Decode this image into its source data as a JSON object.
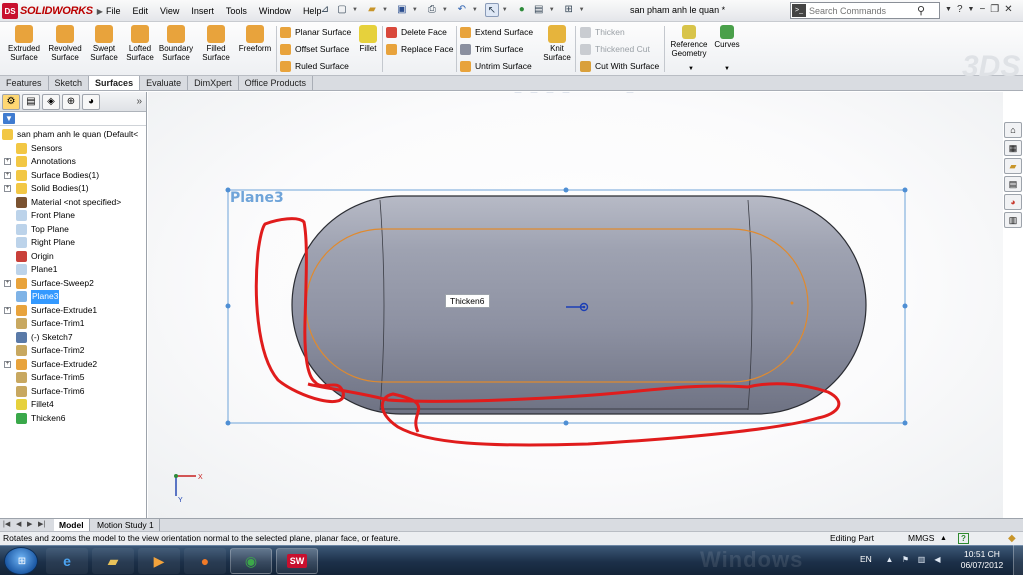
{
  "app": {
    "logo_text": "SOLIDWORKS",
    "logo_badge": "DS",
    "document_title": "san pham anh le quan *",
    "menu": [
      "File",
      "Edit",
      "View",
      "Insert",
      "Tools",
      "Window",
      "Help"
    ],
    "search_placeholder": "Search Commands",
    "watermark": "3DS"
  },
  "ribbon": {
    "big_buttons": [
      {
        "label1": "Extruded",
        "label2": "Surface",
        "icon": "extruded-surface-icon",
        "color": "#e8a33c"
      },
      {
        "label1": "Revolved",
        "label2": "Surface",
        "icon": "revolved-surface-icon",
        "color": "#e8a33c"
      },
      {
        "label1": "Swept",
        "label2": "Surface",
        "icon": "swept-surface-icon",
        "color": "#e8a33c"
      },
      {
        "label1": "Lofted",
        "label2": "Surface",
        "icon": "lofted-surface-icon",
        "color": "#e8a33c"
      },
      {
        "label1": "Boundary",
        "label2": "Surface",
        "icon": "boundary-surface-icon",
        "color": "#e8a33c"
      },
      {
        "label1": "Filled",
        "label2": "Surface",
        "icon": "filled-surface-icon",
        "color": "#e8a33c"
      },
      {
        "label1": "Freeform",
        "label2": "",
        "icon": "freeform-icon",
        "color": "#e8a33c"
      }
    ],
    "col1": [
      "Planar Surface",
      "Offset Surface",
      "Ruled Surface"
    ],
    "fillet": "Fillet",
    "col2": [
      "Delete Face",
      "Replace Face"
    ],
    "col3": [
      "Extend Surface",
      "Trim Surface",
      "Untrim Surface"
    ],
    "knit": {
      "label1": "Knit",
      "label2": "Surface"
    },
    "col4": [
      "Thicken",
      "Thickened Cut",
      "Cut With Surface"
    ],
    "ref_geometry": {
      "label1": "Reference",
      "label2": "Geometry"
    },
    "curves": "Curves"
  },
  "tabs": [
    "Features",
    "Sketch",
    "Surfaces",
    "Evaluate",
    "DimXpert",
    "Office Products"
  ],
  "active_tab": "Surfaces",
  "tree": {
    "root": "san pham anh le quan  (Default<",
    "items": [
      {
        "label": "Sensors",
        "expandable": false,
        "icon_color": "#f2c744"
      },
      {
        "label": "Annotations",
        "expandable": true,
        "icon_color": "#f2c744"
      },
      {
        "label": "Surface Bodies(1)",
        "expandable": true,
        "icon_color": "#f2c744"
      },
      {
        "label": "Solid Bodies(1)",
        "expandable": true,
        "icon_color": "#f2c744"
      },
      {
        "label": "Material <not specified>",
        "expandable": false,
        "icon_color": "#7a5230"
      },
      {
        "label": "Front Plane",
        "expandable": false,
        "icon_color": "#bcd3ea"
      },
      {
        "label": "Top Plane",
        "expandable": false,
        "icon_color": "#bcd3ea"
      },
      {
        "label": "Right Plane",
        "expandable": false,
        "icon_color": "#bcd3ea"
      },
      {
        "label": "Origin",
        "expandable": false,
        "icon_color": "#c9403a"
      },
      {
        "label": "Plane1",
        "expandable": false,
        "icon_color": "#bcd3ea"
      },
      {
        "label": "Surface-Sweep2",
        "expandable": true,
        "icon_color": "#e8a33c"
      },
      {
        "label": "Plane3",
        "expandable": false,
        "icon_color": "#7fb3e6",
        "selected": true
      },
      {
        "label": "Surface-Extrude1",
        "expandable": true,
        "icon_color": "#e8a33c"
      },
      {
        "label": "Surface-Trim1",
        "expandable": false,
        "icon_color": "#c8a860"
      },
      {
        "label": "(-) Sketch7",
        "expandable": false,
        "icon_color": "#5a7aa8"
      },
      {
        "label": "Surface-Trim2",
        "expandable": false,
        "icon_color": "#c8a860"
      },
      {
        "label": "Surface-Extrude2",
        "expandable": true,
        "icon_color": "#e8a33c"
      },
      {
        "label": "Surface-Trim5",
        "expandable": false,
        "icon_color": "#c8a860"
      },
      {
        "label": "Surface-Trim6",
        "expandable": false,
        "icon_color": "#c8a860"
      },
      {
        "label": "Fillet4",
        "expandable": false,
        "icon_color": "#e6d13c"
      },
      {
        "label": "Thicken6",
        "expandable": false,
        "icon_color": "#3aa84a"
      }
    ]
  },
  "graphics": {
    "plane_label": "Plane3",
    "tooltip": "Thicken6",
    "colors": {
      "plane_border": "#6fa4d9",
      "body": "#8a8f9f",
      "edge": "#e08a2e",
      "markup": "#e01c1c"
    }
  },
  "bottom_tabs": [
    "Model",
    "Motion Study 1"
  ],
  "status": {
    "message": "Rotates and zooms the model to the view orientation normal to the selected plane, planar face, or feature.",
    "editing": "Editing Part",
    "units": "MMGS"
  },
  "taskbar": {
    "language": "EN",
    "time": "10:51 CH",
    "date": "06/07/2012",
    "watermark": "Windows"
  }
}
